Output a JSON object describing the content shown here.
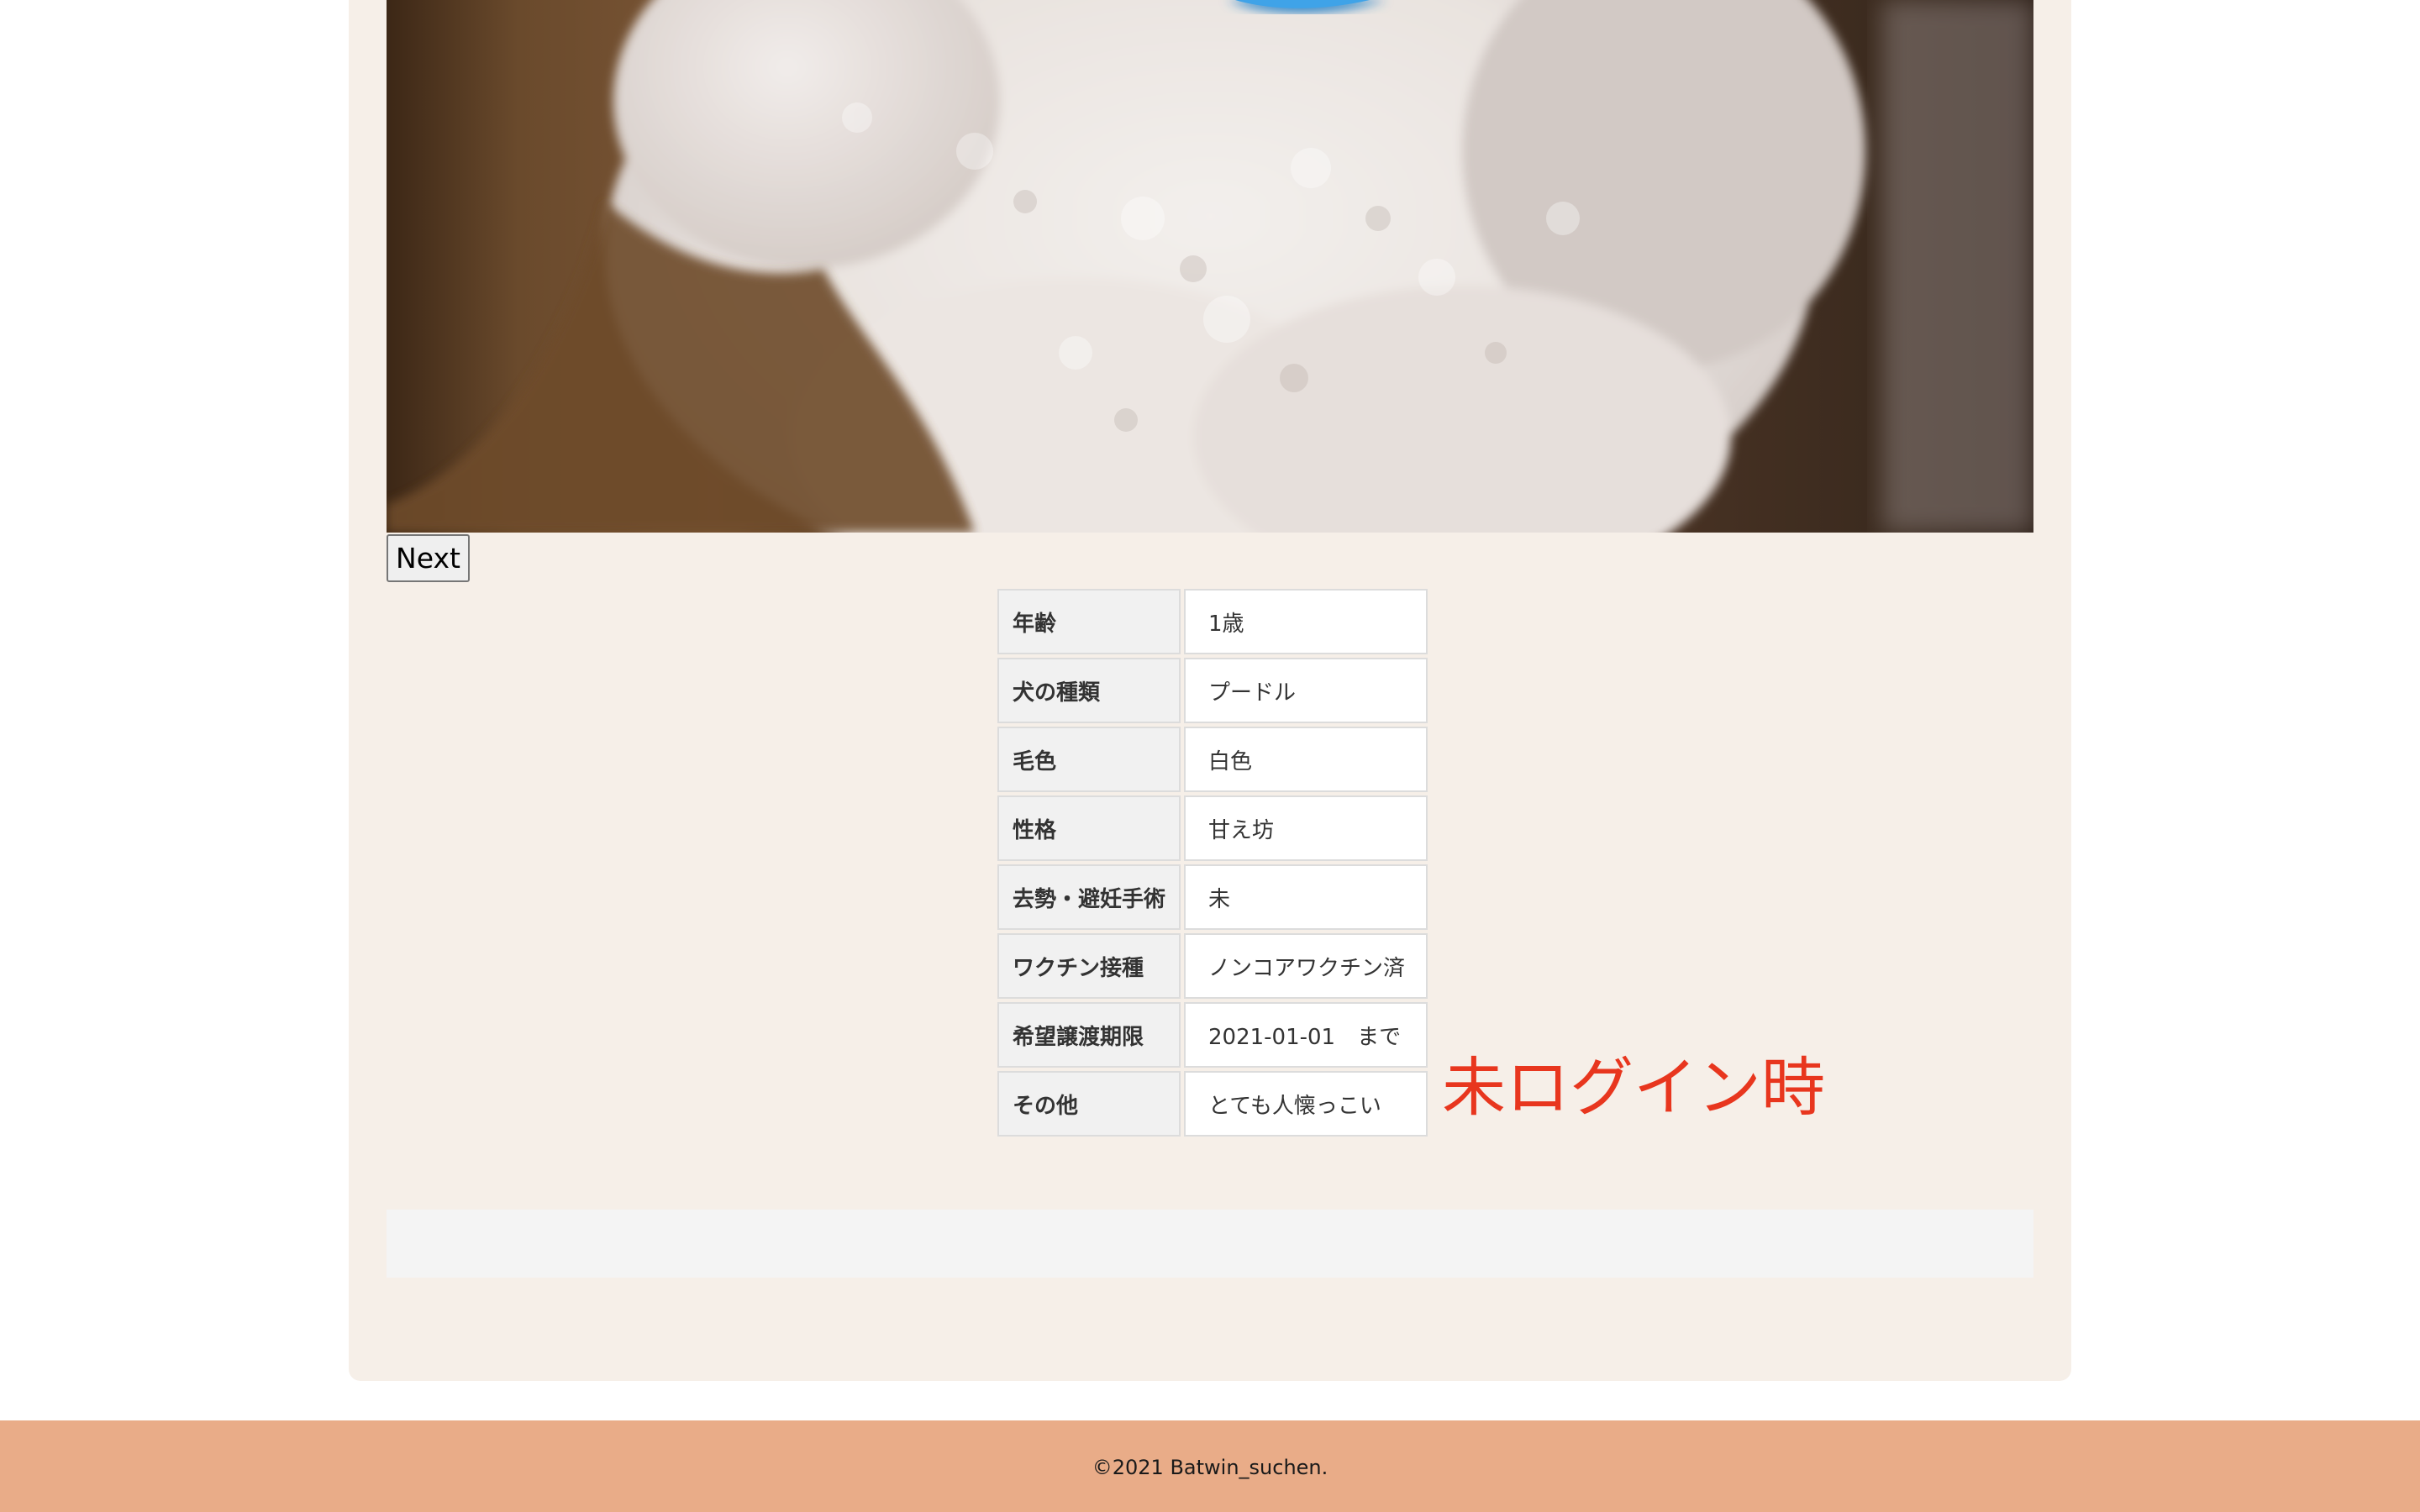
{
  "gallery": {
    "photo_alt": "白いプードル",
    "next_label": "Next"
  },
  "details": {
    "rows": [
      {
        "label": "年齢",
        "value": "1歳"
      },
      {
        "label": "犬の種類",
        "value": "プードル"
      },
      {
        "label": "毛色",
        "value": "白色"
      },
      {
        "label": "性格",
        "value": "甘え坊"
      },
      {
        "label": "去勢・避妊手術",
        "value": "未"
      },
      {
        "label": "ワクチン接種",
        "value": "ノンコアワクチン済"
      },
      {
        "label": "希望譲渡期限",
        "value": "2021-01-01　まで"
      },
      {
        "label": "その他",
        "value": "とても人懐っこい"
      }
    ]
  },
  "annotation": {
    "text": "未ログイン時",
    "color": "#e8361e"
  },
  "footer": {
    "copyright": "©2021 Batwin_suchen.",
    "background": "#e9ac88"
  },
  "colors": {
    "card_background": "#f6efe8",
    "page_background": "#ffffff"
  }
}
